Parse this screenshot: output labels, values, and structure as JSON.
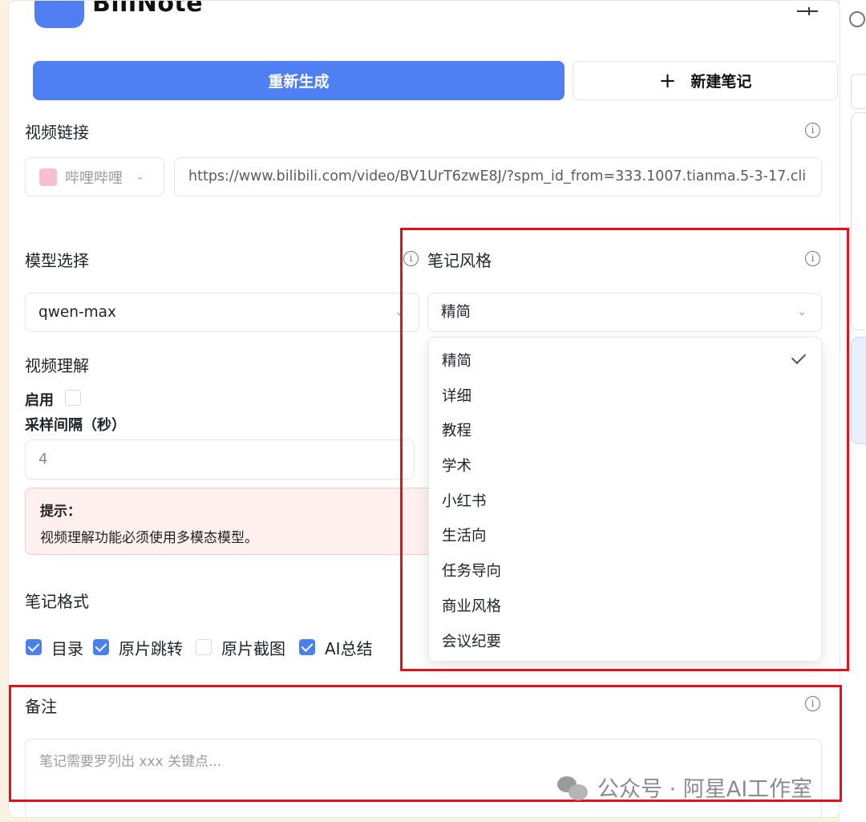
{
  "app": {
    "name": "BiliNote"
  },
  "actions": {
    "regenerate_label": "重新生成",
    "new_note_label": "新建笔记",
    "new_note_icon": "plus-icon"
  },
  "video_link": {
    "label": "视频链接",
    "platform": "哔哩哔哩",
    "url": "https://www.bilibili.com/video/BV1UrT6zwE8J/?spm_id_from=333.1007.tianma.5-3-17.cli"
  },
  "model": {
    "label": "模型选择",
    "value": "qwen-max"
  },
  "note_style": {
    "label": "笔记风格",
    "value": "精简",
    "options": [
      "精简",
      "详细",
      "教程",
      "学术",
      "小红书",
      "生活向",
      "任务导向",
      "商业风格",
      "会议纪要"
    ],
    "selected": "精简"
  },
  "video_understanding": {
    "label": "视频理解",
    "enable_label": "启用",
    "enabled": false,
    "interval_label": "采样间隔（秒）",
    "interval_value": "4"
  },
  "hint": {
    "title": "提示：",
    "text": "视频理解功能必须使用多模态模型。"
  },
  "note_format": {
    "label": "笔记格式",
    "options": [
      {
        "label": "目录",
        "checked": true
      },
      {
        "label": "原片跳转",
        "checked": true
      },
      {
        "label": "原片截图",
        "checked": false
      },
      {
        "label": "AI总结",
        "checked": true
      }
    ]
  },
  "remarks": {
    "label": "备注",
    "placeholder": "笔记需要罗列出 xxx 关键点..."
  },
  "watermark": {
    "text": "公众号 · 阿星AI工作室"
  },
  "colors": {
    "primary": "#4e80f3",
    "highlight": "#e8101a",
    "hint_bg": "#fdf0ef"
  }
}
